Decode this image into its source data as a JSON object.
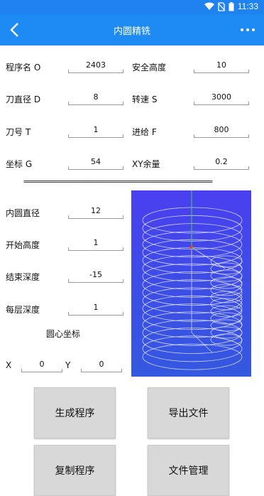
{
  "status_bar": {
    "time": "11:33",
    "icons": [
      "wifi-icon",
      "no-sim-icon",
      "battery-icon"
    ]
  },
  "app_bar": {
    "title": "内圆精铣",
    "back_icon": "chevron-left-icon",
    "more_icon": "more-dots-icon"
  },
  "params": {
    "program_name": {
      "label": "程序名 O",
      "value": "2403"
    },
    "safe_height": {
      "label": "安全高度",
      "value": "10"
    },
    "tool_diameter": {
      "label": "刀直径 D",
      "value": "8"
    },
    "spindle_speed": {
      "label": "转速 S",
      "value": "3000"
    },
    "tool_number": {
      "label": "刀号 T",
      "value": "1"
    },
    "feed_rate": {
      "label": "进给 F",
      "value": "800"
    },
    "coordinate": {
      "label": "坐标 G",
      "value": "54"
    },
    "xy_allowance": {
      "label": "XY余量",
      "value": "0.2"
    }
  },
  "divider_text": "=================================================",
  "circle": {
    "inner_diameter": {
      "label": "内圆直径",
      "value": "12"
    },
    "start_height": {
      "label": "开始高度",
      "value": "1"
    },
    "end_depth": {
      "label": "结束深度",
      "value": "-15"
    },
    "layer_depth": {
      "label": "每层深度",
      "value": "1"
    },
    "center_title": "圆心坐标",
    "x": {
      "label": "X",
      "value": "0"
    },
    "y": {
      "label": "Y",
      "value": "0"
    }
  },
  "buttons": {
    "generate": "生成程序",
    "export": "导出文件",
    "copy": "复制程序",
    "files": "文件管理"
  },
  "colors": {
    "appbar": "#1e8bf5",
    "statusbar": "#1e83f0",
    "preview_bg": "#3d4de6",
    "button_bg": "#d8d8d8"
  }
}
